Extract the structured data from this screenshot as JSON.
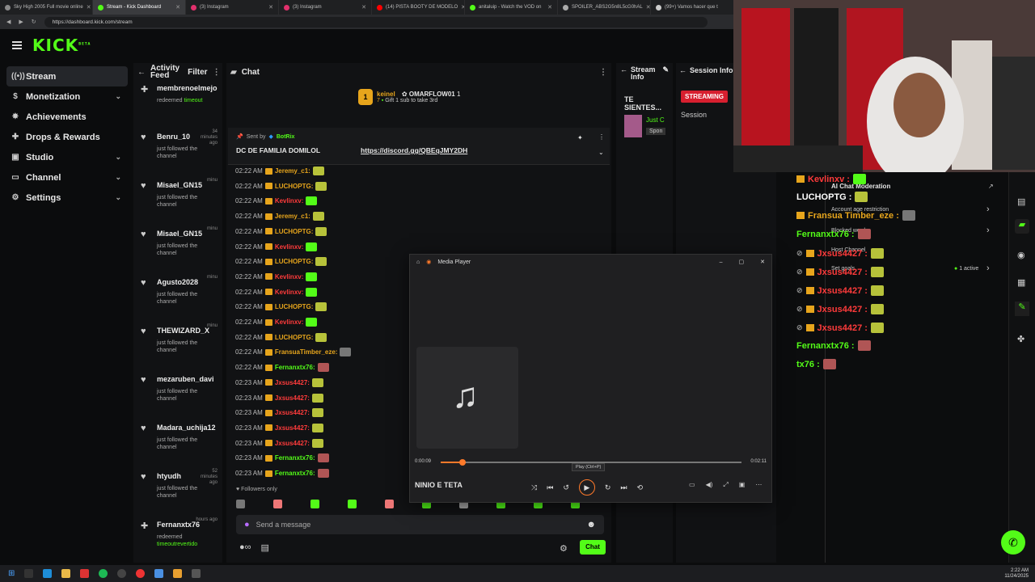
{
  "browser": {
    "tabs": [
      {
        "label": "Sky High 2005 Full movie online",
        "color": "#8a8a8a"
      },
      {
        "label": "Stream - Kick Dashboard",
        "color": "#53fc18",
        "active": true
      },
      {
        "label": "(3) Instagram",
        "color": "#e1306c"
      },
      {
        "label": "(3) Instagram",
        "color": "#e1306c"
      },
      {
        "label": "(14) PISTA BOOTY DE MODELO",
        "color": "#ff0000"
      },
      {
        "label": "anitaluip - Watch the VOD on",
        "color": "#53fc18"
      },
      {
        "label": "SPOILER_ABS2G5n8L5cG0hAL",
        "color": "#aaaaaa"
      },
      {
        "label": "(99+) Vamos hacer que t",
        "color": "#cccccc"
      }
    ],
    "url": "https://dashboard.kick.com/stream"
  },
  "brand": {
    "logo": "KICK",
    "sup": "BETA",
    "accent": "#53fc18"
  },
  "sidebar": {
    "items": [
      {
        "label": "Stream",
        "icon": "broadcast-icon",
        "glyph": "((•))",
        "active": true,
        "chev": false
      },
      {
        "label": "Monetization",
        "icon": "dollar-icon",
        "glyph": "$",
        "chev": true
      },
      {
        "label": "Achievements",
        "icon": "gear-icon",
        "glyph": "✸",
        "chev": false
      },
      {
        "label": "Drops & Rewards",
        "icon": "gift-icon",
        "glyph": "✚",
        "chev": false
      },
      {
        "label": "Studio",
        "icon": "studio-icon",
        "glyph": "▣",
        "chev": true
      },
      {
        "label": "Channel",
        "icon": "tv-icon",
        "glyph": "▭",
        "chev": true
      },
      {
        "label": "Settings",
        "icon": "gear-icon",
        "glyph": "⚙",
        "chev": true
      }
    ]
  },
  "feed": {
    "title": "Activity Feed",
    "filter": "Filter",
    "items": [
      {
        "name": "membrenoelmejo",
        "time": "",
        "text": "redeemed",
        "highlight": "timeout",
        "icon": "gift-icon",
        "glyph": "✚"
      },
      {
        "name": "Benru_10",
        "time": "34 minutes ago",
        "text": "just followed the channel",
        "highlight": "",
        "icon": "heart-icon",
        "glyph": "♥"
      },
      {
        "name": "Misael_GN15",
        "time": "minu",
        "text": "just followed the channel",
        "highlight": "",
        "icon": "heart-icon",
        "glyph": "♥"
      },
      {
        "name": "Misael_GN15",
        "time": "minu",
        "text": "just followed the channel",
        "highlight": "",
        "icon": "heart-icon",
        "glyph": "♥"
      },
      {
        "name": "Agusto2028",
        "time": "minu",
        "text": "just followed the channel",
        "highlight": "",
        "icon": "heart-icon",
        "glyph": "♥"
      },
      {
        "name": "THEWIZARD_X",
        "time": "minu",
        "text": "just followed the channel",
        "highlight": "",
        "icon": "heart-icon",
        "glyph": "♥"
      },
      {
        "name": "mezaruben_davi",
        "time": "",
        "text": "just followed the channel",
        "highlight": "",
        "icon": "heart-icon",
        "glyph": "♥"
      },
      {
        "name": "Madara_uchija12",
        "time": "",
        "text": "just followed the channel",
        "highlight": "",
        "icon": "heart-icon",
        "glyph": "♥"
      },
      {
        "name": "htyudh",
        "time": "52 minutes ago",
        "text": "just followed the channel",
        "highlight": "",
        "icon": "heart-icon",
        "glyph": "♥"
      },
      {
        "name": "Fernanxtx76",
        "time": "hours ago",
        "text": "redeemed",
        "highlight": "timeoutrevertido",
        "icon": "gift-icon",
        "glyph": "✚"
      }
    ]
  },
  "chat": {
    "title": "Chat",
    "gift": {
      "user": "keinel",
      "count": "7",
      "recipient": "OMARFLOW01",
      "num": "1",
      "text": "Gift 1 sub to take 3rd"
    },
    "pinned": {
      "sent_by_label": "Sent by",
      "bot": "BotRix",
      "text": "DC DE FAMILIA DOMILOL",
      "link": "https://discord.gg/QBEqJMY2DH"
    },
    "messages": [
      {
        "time": "02:22 AM",
        "user": "Jeremy_c1:",
        "color": "#e7a51c",
        "emote": "#b7c23a"
      },
      {
        "time": "02:22 AM",
        "user": "LUCHOPTG:",
        "color": "#e7a51c",
        "emote": "#b7c23a"
      },
      {
        "time": "02:22 AM",
        "user": "Kevlinxv:",
        "color": "#ff3b3b",
        "emote": "#53fc18"
      },
      {
        "time": "02:22 AM",
        "user": "Jeremy_c1:",
        "color": "#e7a51c",
        "emote": "#b7c23a"
      },
      {
        "time": "02:22 AM",
        "user": "LUCHOPTG:",
        "color": "#e7a51c",
        "emote": "#b7c23a"
      },
      {
        "time": "02:22 AM",
        "user": "Kevlinxv:",
        "color": "#ff3b3b",
        "emote": "#53fc18"
      },
      {
        "time": "02:22 AM",
        "user": "LUCHOPTG:",
        "color": "#e7a51c",
        "emote": "#b7c23a"
      },
      {
        "time": "02:22 AM",
        "user": "Kevlinxv:",
        "color": "#ff3b3b",
        "emote": "#53fc18"
      },
      {
        "time": "02:22 AM",
        "user": "Kevlinxv:",
        "color": "#ff3b3b",
        "emote": "#53fc18"
      },
      {
        "time": "02:22 AM",
        "user": "LUCHOPTG:",
        "color": "#e7a51c",
        "emote": "#b7c23a"
      },
      {
        "time": "02:22 AM",
        "user": "Kevlinxv:",
        "color": "#ff3b3b",
        "emote": "#53fc18"
      },
      {
        "time": "02:22 AM",
        "user": "LUCHOPTG:",
        "color": "#e7a51c",
        "emote": "#b7c23a"
      },
      {
        "time": "02:22 AM",
        "user": "FransuaTimber_eze:",
        "color": "#e7a51c",
        "emote": "#777777"
      },
      {
        "time": "02:22 AM",
        "user": "Fernanxtx76:",
        "color": "#53fc18",
        "emote": "#b05555"
      },
      {
        "time": "02:23 AM",
        "user": "Jxsus4427:",
        "color": "#ff3b3b",
        "emote": "#b7c23a"
      },
      {
        "time": "02:23 AM",
        "user": "Jxsus4427:",
        "color": "#ff3b3b",
        "emote": "#b7c23a"
      },
      {
        "time": "02:23 AM",
        "user": "Jxsus4427:",
        "color": "#ff3b3b",
        "emote": "#b7c23a"
      },
      {
        "time": "02:23 AM",
        "user": "Jxsus4427:",
        "color": "#ff3b3b",
        "emote": "#b7c23a"
      },
      {
        "time": "02:23 AM",
        "user": "Jxsus4427:",
        "color": "#ff3b3b",
        "emote": "#b7c23a"
      },
      {
        "time": "02:23 AM",
        "user": "Fernanxtx76:",
        "color": "#53fc18",
        "emote": "#b05555"
      },
      {
        "time": "02:23 AM",
        "user": "Fernanxtx76:",
        "color": "#53fc18",
        "emote": "#b05555"
      }
    ],
    "followers_only": "Followers only",
    "input_placeholder": "Send a message",
    "send_label": "Chat"
  },
  "stream_info": {
    "title": "Stream Info",
    "stream_title": "TE SIENTES...",
    "just": "Just C",
    "spon": "Spon"
  },
  "session": {
    "title": "Session Info",
    "status": "STREAMING",
    "label": "Session"
  },
  "overlay": {
    "moderation": "AI Chat Moderation",
    "account_restriction": "Account age restriction",
    "blocked_words": "Blocked words",
    "host_channel": "Host Channel",
    "set_goals": "Set goals",
    "active": "1 active",
    "messages": [
      {
        "user": "Kevlinxv :",
        "color": "#ff3b3b",
        "emote": "#53fc18",
        "badge": true,
        "mod": false
      },
      {
        "user": "LUCHOPTG :",
        "color": "#ffffff",
        "emote": "#b7c23a",
        "badge": false,
        "mod": false
      },
      {
        "user": "Fransua Timber_eze :",
        "color": "#e7a51c",
        "emote": "#777777",
        "badge": true,
        "mod": false
      },
      {
        "user": "Fernanxtx76 :",
        "color": "#53fc18",
        "emote": "#b05555",
        "badge": false,
        "mod": false
      },
      {
        "user": "Jxsus4427 :",
        "color": "#ff3b3b",
        "emote": "#b7c23a",
        "badge": true,
        "mod": true
      },
      {
        "user": "Jxsus4427 :",
        "color": "#ff3b3b",
        "emote": "#b7c23a",
        "badge": true,
        "mod": true
      },
      {
        "user": "Jxsus4427 :",
        "color": "#ff3b3b",
        "emote": "#b7c23a",
        "badge": true,
        "mod": true
      },
      {
        "user": "Jxsus4427 :",
        "color": "#ff3b3b",
        "emote": "#b7c23a",
        "badge": true,
        "mod": true
      },
      {
        "user": "Jxsus4427 :",
        "color": "#ff3b3b",
        "emote": "#b7c23a",
        "badge": true,
        "mod": true
      },
      {
        "user": "Fernanxtx76 :",
        "color": "#53fc18",
        "emote": "#b05555",
        "badge": false,
        "mod": false
      },
      {
        "user": "tx76 :",
        "color": "#53fc18",
        "emote": "#b05555",
        "badge": false,
        "mod": false
      }
    ]
  },
  "media_player": {
    "title": "Media Player",
    "track": "NINIO E TETA",
    "elapsed": "0:00:09",
    "duration": "0:02:11",
    "progress": 0.072,
    "tooltip": "Play (Ctrl+P)"
  },
  "taskbar": {
    "time": "2:22 AM",
    "date": "11/24/2025"
  }
}
